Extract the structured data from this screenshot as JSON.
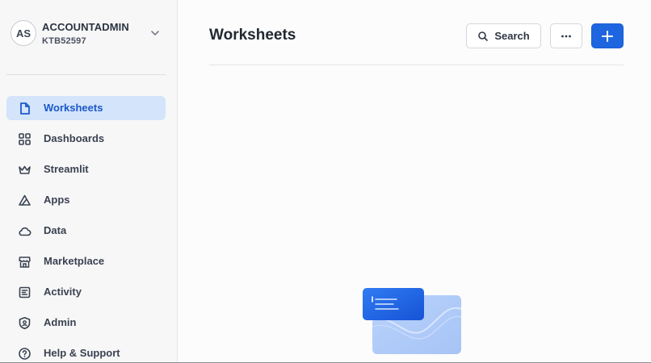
{
  "account": {
    "initials": "AS",
    "role": "ACCOUNTADMIN",
    "account_id": "KTB52597"
  },
  "sidebar": {
    "items": [
      {
        "label": "Worksheets",
        "icon": "worksheet-icon",
        "active": true
      },
      {
        "label": "Dashboards",
        "icon": "grid-icon",
        "active": false
      },
      {
        "label": "Streamlit",
        "icon": "crown-icon",
        "active": false
      },
      {
        "label": "Apps",
        "icon": "apps-icon",
        "active": false
      },
      {
        "label": "Data",
        "icon": "cloud-icon",
        "active": false
      },
      {
        "label": "Marketplace",
        "icon": "storefront-icon",
        "active": false
      },
      {
        "label": "Activity",
        "icon": "activity-icon",
        "active": false
      },
      {
        "label": "Admin",
        "icon": "shield-icon",
        "active": false
      },
      {
        "label": "Help & Support",
        "icon": "help-icon",
        "active": false
      }
    ]
  },
  "main": {
    "title": "Worksheets",
    "search_label": "Search",
    "more_icon": "ellipsis-icon",
    "add_icon": "plus-icon"
  },
  "colors": {
    "accent": "#1e66e0",
    "active_nav_bg": "#d3e4fb",
    "active_nav_text": "#1b59c9"
  }
}
